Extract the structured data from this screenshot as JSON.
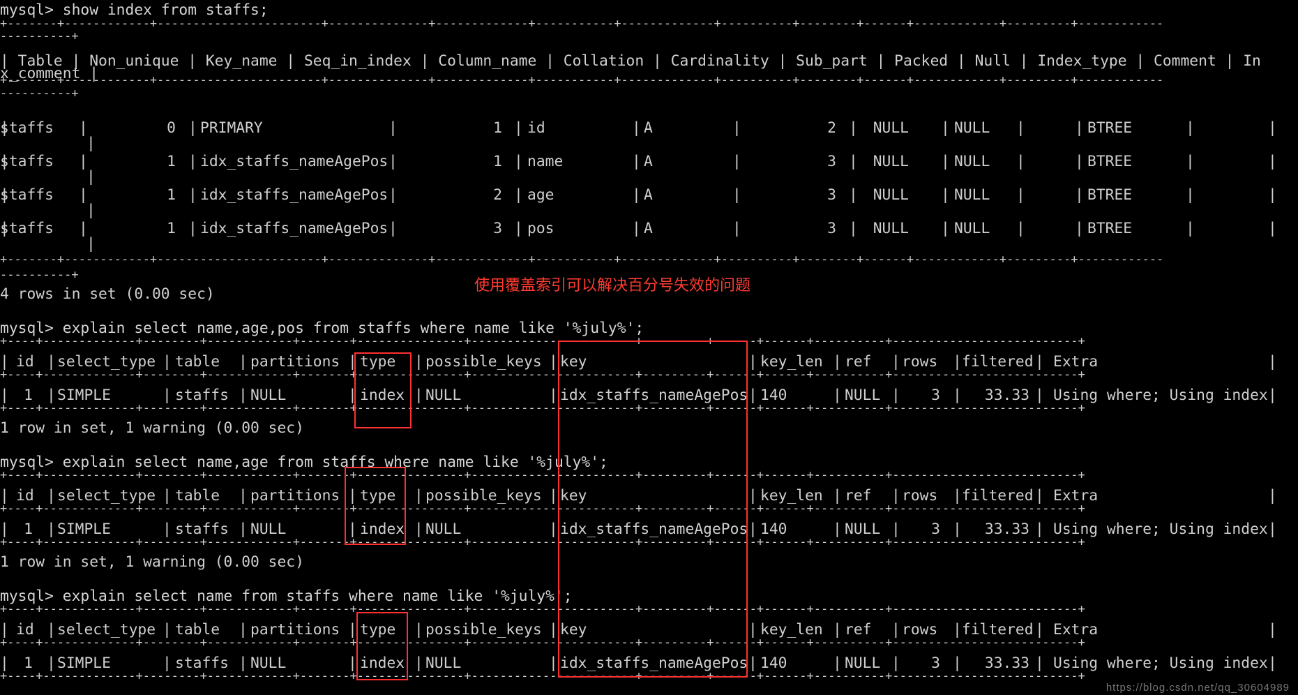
{
  "window": {
    "background": "#000000",
    "foreground": "#cfcfcf",
    "highlight_color": "#ff3030",
    "note_color": "#ff3b30"
  },
  "session": {
    "prompt1": "mysql> show index from staffs;",
    "header1_a": "| Table | Non_unique | Key_name | Seq_in_index | Column_name | Collation | Cardinality | Sub_part | Packed | Null | Index_type | Comment | In",
    "header1_b": "x_comment |",
    "index_rows": [
      {
        "table": "staffs",
        "non_unique": "0",
        "key_name": "PRIMARY",
        "seq": "1",
        "column": "id",
        "collation": "A",
        "cardinality": "2",
        "sub_part": "NULL",
        "packed": "NULL",
        "null": "",
        "index_type": "BTREE"
      },
      {
        "table": "staffs",
        "non_unique": "1",
        "key_name": "idx_staffs_nameAgePos",
        "seq": "1",
        "column": "name",
        "collation": "A",
        "cardinality": "3",
        "sub_part": "NULL",
        "packed": "NULL",
        "null": "",
        "index_type": "BTREE"
      },
      {
        "table": "staffs",
        "non_unique": "1",
        "key_name": "idx_staffs_nameAgePos",
        "seq": "2",
        "column": "age",
        "collation": "A",
        "cardinality": "3",
        "sub_part": "NULL",
        "packed": "NULL",
        "null": "",
        "index_type": "BTREE"
      },
      {
        "table": "staffs",
        "non_unique": "1",
        "key_name": "idx_staffs_nameAgePos",
        "seq": "3",
        "column": "pos",
        "collation": "A",
        "cardinality": "3",
        "sub_part": "NULL",
        "packed": "NULL",
        "null": "",
        "index_type": "BTREE"
      }
    ],
    "result1": "4 rows in set (0.00 sec)",
    "note": "使用覆盖索引可以解决百分号失效的问题",
    "explains": [
      {
        "prompt": "mysql> explain select name,age,pos from staffs where name like '%july%';",
        "result": "1 row in set, 1 warning (0.00 sec)"
      },
      {
        "prompt": "mysql> explain select name,age from staffs where name like '%july%';",
        "result": "1 row in set, 1 warning (0.00 sec)"
      },
      {
        "prompt": "mysql> explain select name from staffs where name like '%july%';",
        "result": ""
      }
    ],
    "explain_headers": {
      "id": "id",
      "select_type": "select_type",
      "table": "table",
      "partitions": "partitions",
      "type": "type",
      "possible_keys": "possible_keys",
      "key": "key",
      "key_len": "key_len",
      "ref": "ref",
      "rows": "rows",
      "filtered": "filtered",
      "extra": "Extra"
    },
    "explain_row": {
      "id": "1",
      "select_type": "SIMPLE",
      "table": "staffs",
      "partitions": "NULL",
      "type": "index",
      "possible_keys": "NULL",
      "key": "idx_staffs_nameAgePos",
      "key_len": "140",
      "ref": "NULL",
      "rows": "3",
      "filtered": "33.33",
      "extra": "Using where; Using index"
    },
    "watermark": "https://blog.csdn.net/qq_30604989"
  }
}
